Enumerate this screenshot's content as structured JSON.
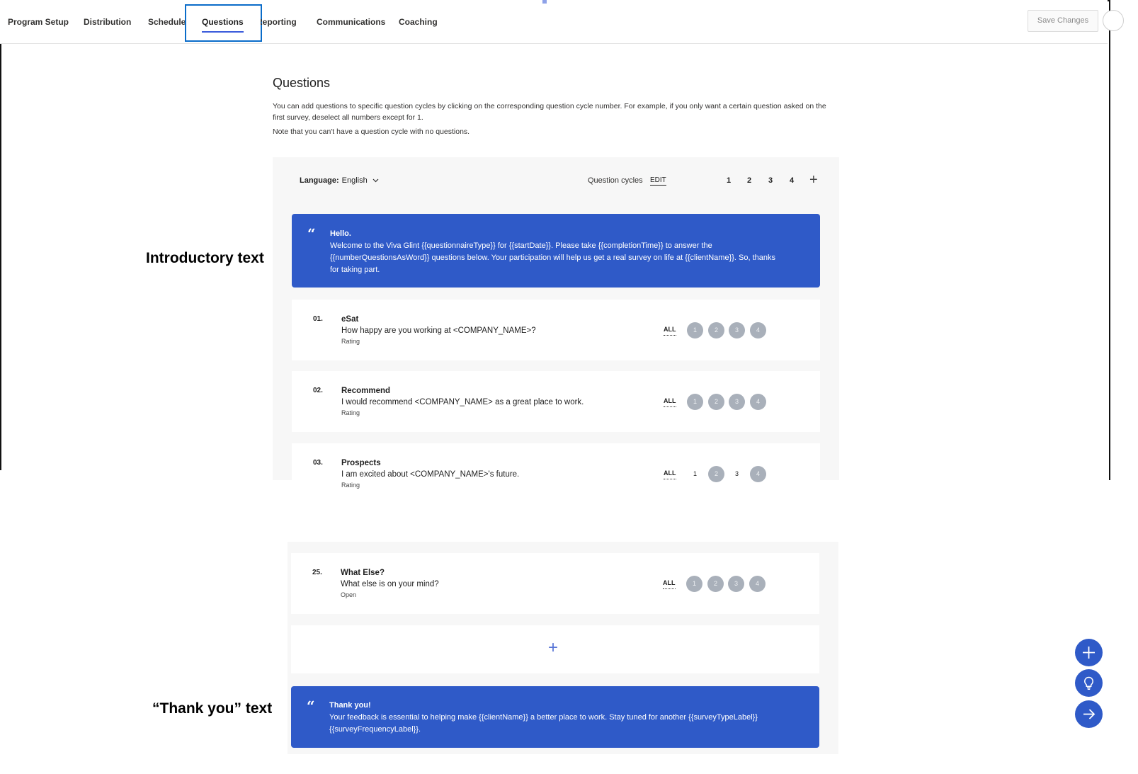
{
  "nav": {
    "items": [
      {
        "label": "Program Setup"
      },
      {
        "label": "Distribution"
      },
      {
        "label": "Schedule"
      },
      {
        "label": "Questions"
      },
      {
        "label": "Reporting"
      },
      {
        "label": "Communications"
      },
      {
        "label": "Coaching"
      }
    ],
    "active": "Questions",
    "save_label": "Save Changes"
  },
  "page": {
    "title": "Questions",
    "description": "You can add questions to specific question cycles by clicking on the corresponding question cycle number. For example, if you only want a certain question asked on the first survey, deselect all numbers except for 1.",
    "note": "Note that you can't have a question cycle with no questions."
  },
  "toolbar": {
    "language_label": "Language:",
    "language_value": "English",
    "cycles_label": "Question cycles",
    "edit_label": "EDIT",
    "cycles": [
      "1",
      "2",
      "3",
      "4"
    ],
    "add_symbol": "+"
  },
  "intro": {
    "quote": "“",
    "greeting": "Hello.",
    "body": "Welcome to the Viva Glint {{questionnaireType}} for {{startDate}}. Please take {{completionTime}} to answer the {{numberQuestionsAsWord}} questions below. Your participation will help us get a real survey on life at {{clientName}}. So, thanks for taking part."
  },
  "questions": [
    {
      "num": "01.",
      "title": "eSat",
      "text": "How happy are you working at <COMPANY_NAME>?",
      "type": "Rating",
      "all": "ALL",
      "cycles": [
        "1",
        "2",
        "3",
        "4"
      ],
      "selected": [
        true,
        true,
        true,
        true
      ]
    },
    {
      "num": "02.",
      "title": "Recommend",
      "text": "I would recommend <COMPANY_NAME> as a great place to work.",
      "type": "Rating",
      "all": "ALL",
      "cycles": [
        "1",
        "2",
        "3",
        "4"
      ],
      "selected": [
        true,
        true,
        true,
        true
      ]
    },
    {
      "num": "03.",
      "title": "Prospects",
      "text": "I am excited about <COMPANY_NAME>'s future.",
      "type": "Rating",
      "all": "ALL",
      "cycles": [
        "1",
        "2",
        "3",
        "4"
      ],
      "selected": [
        false,
        true,
        false,
        true
      ]
    },
    {
      "num": "25.",
      "title": "What Else?",
      "text": "What else is on your mind?",
      "type": "Open",
      "all": "ALL",
      "cycles": [
        "1",
        "2",
        "3",
        "4"
      ],
      "selected": [
        true,
        true,
        true,
        true
      ]
    }
  ],
  "add_question_symbol": "+",
  "thanks": {
    "quote": "“",
    "greeting": "Thank you!",
    "body": "Your feedback is essential to helping make {{clientName}} a better place to work. Stay tuned for another {{surveyTypeLabel}} {{surveyFrequencyLabel}}."
  },
  "annotations": {
    "intro": "Introductory text",
    "thanks": "“Thank you” text"
  },
  "fabs": [
    {
      "icon": "plus-icon"
    },
    {
      "icon": "lightbulb-icon"
    },
    {
      "icon": "arrow-right-icon"
    }
  ],
  "colors": {
    "accent": "#2f5ac8",
    "highlight": "#0a6cc9",
    "inactive_cycle": "#a9b0ba"
  }
}
